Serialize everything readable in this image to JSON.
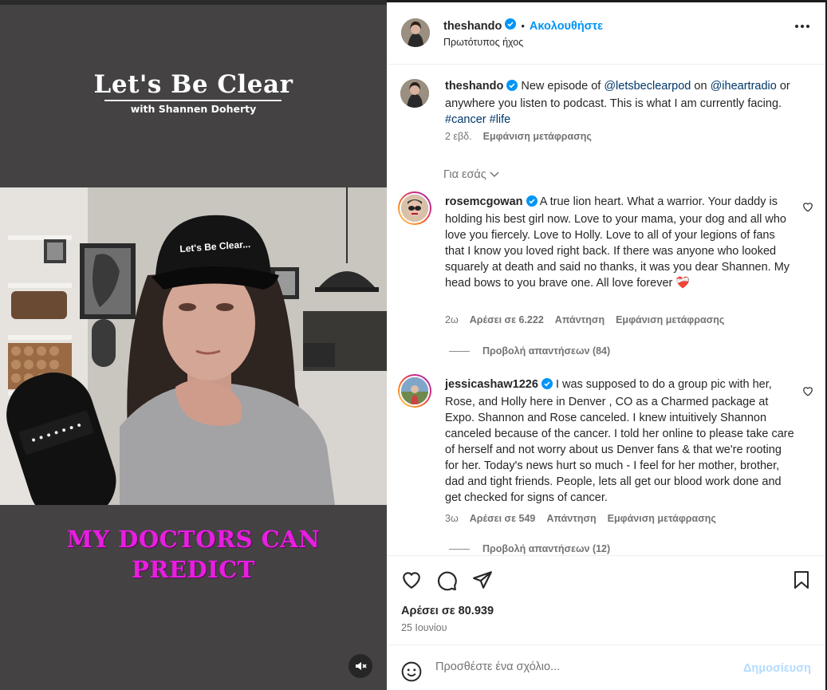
{
  "media": {
    "logo_title": "Let's Be Clear",
    "logo_subtitle": "with Shannen Doherty",
    "cap_text": "Let's Be Clear...",
    "caption_line1": "MY DOCTORS CAN",
    "caption_line2": "PREDICT",
    "mute_icon": "speaker-muted-icon"
  },
  "header": {
    "username": "theshando",
    "separator": "•",
    "follow_label": "Ακολουθήστε",
    "audio_label": "Πρωτότυπος ήχος"
  },
  "post": {
    "username": "theshando",
    "text_1": "New episode of",
    "mention_1": "@letsbeclearpod",
    "text_2": "on",
    "mention_2": "@iheartradio",
    "text_3": "or anywhere you listen to podcast. This is what I am currently facing.",
    "tag_1": "#cancer",
    "tag_2": "#life",
    "age": "2 εβδ.",
    "translate": "Εμφάνιση μετάφρασης"
  },
  "for_you": "Για εσάς",
  "comments": [
    {
      "username": "rosemcgowan",
      "text": "A true lion heart. What a warrior. Your daddy is holding his best girl now. Love to your mama, your dog and all who love you fiercely. Love to Holly. Love to all of your legions of fans that I know you loved right back. If there was anyone who looked squarely at death and said no thanks, it was you dear Shannen. My head bows to you brave one. All love forever",
      "emoji": "❤️‍🩹",
      "age": "2ω",
      "likes": "Αρέσει σε 6.222",
      "reply": "Απάντηση",
      "translate": "Εμφάνιση μετάφρασης",
      "view_replies": "Προβολή απαντήσεων (84)"
    },
    {
      "username": "jessicashaw1226",
      "text": "I was supposed to do a group pic with her, Rose, and Holly here in Denver , CO as a Charmed package at Expo. Shannon and Rose canceled. I knew intuitively Shannon canceled because of the cancer. I told her online to please take care of herself and not worry about us Denver fans & that we're rooting for her. Today's news hurt so much - I feel for her mother, brother, dad and tight friends. People, lets all get our blood work done and get checked for signs of cancer.",
      "age": "3ω",
      "likes": "Αρέσει σε 549",
      "reply": "Απάντηση",
      "translate": "Εμφάνιση μετάφρασης",
      "view_replies": "Προβολή απαντήσεων (12)"
    }
  ],
  "actions": {
    "likes": "Αρέσει σε 80.939",
    "date": "25 Ιουνίου"
  },
  "add_comment": {
    "placeholder": "Προσθέστε ένα σχόλιο...",
    "post_label": "Δημοσίευση"
  },
  "colors": {
    "caption": "#e81ee0",
    "link": "#00376b",
    "verified": "#0095f6",
    "follow": "#0095f6",
    "post_disabled": "#b3dbff"
  }
}
